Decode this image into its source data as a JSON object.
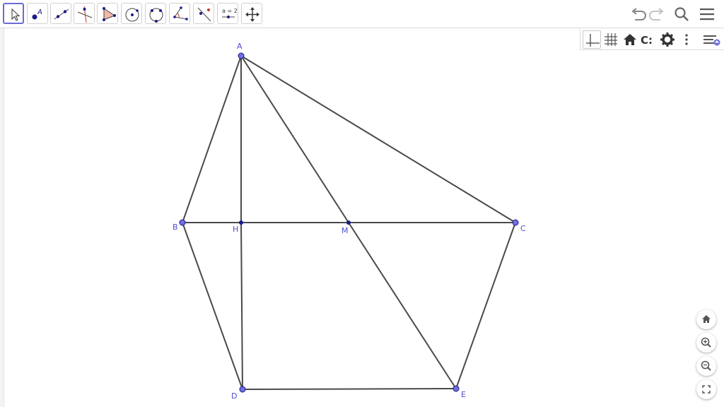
{
  "toolbar": {
    "tools": [
      "move-tool",
      "point-tool",
      "line-tool",
      "perpendicular-line-tool",
      "polygon-tool",
      "circle-center-point-tool",
      "circle-three-points-tool",
      "angle-tool",
      "reflect-tool",
      "slider-tool",
      "move-graphics-view-tool"
    ],
    "slider_label": "a = 2",
    "right_icons": [
      "undo-icon",
      "redo-icon",
      "search-icon",
      "menu-icon"
    ]
  },
  "style_bar": {
    "buttons": [
      "axes-toggle-icon",
      "grid-toggle-icon",
      "home-icon",
      "point-capturing-icon",
      "settings-gear-icon",
      "more-options-icon",
      "style-bar-toggle-icon"
    ],
    "capturing_label": "C:"
  },
  "graphics_buttons": [
    "home-view-icon",
    "zoom-in-icon",
    "zoom-out-icon",
    "fullscreen-icon"
  ],
  "colors": {
    "point_fill": "#6f6fe0",
    "point_dark": "#1a1a8c",
    "segment": "#4a4a4a",
    "label": "#4d4dc9",
    "active_tool_border": "#6b6bd6"
  },
  "geometry": {
    "points": [
      {
        "name": "A",
        "kind": "free"
      },
      {
        "name": "B",
        "kind": "free"
      },
      {
        "name": "C",
        "kind": "free"
      },
      {
        "name": "D",
        "kind": "free"
      },
      {
        "name": "E",
        "kind": "free"
      },
      {
        "name": "H",
        "kind": "dependent"
      },
      {
        "name": "M",
        "kind": "dependent"
      }
    ],
    "segments": [
      "AB",
      "AC",
      "BC",
      "AH",
      "HD",
      "AM",
      "ME",
      "BD",
      "DE",
      "CE"
    ]
  }
}
